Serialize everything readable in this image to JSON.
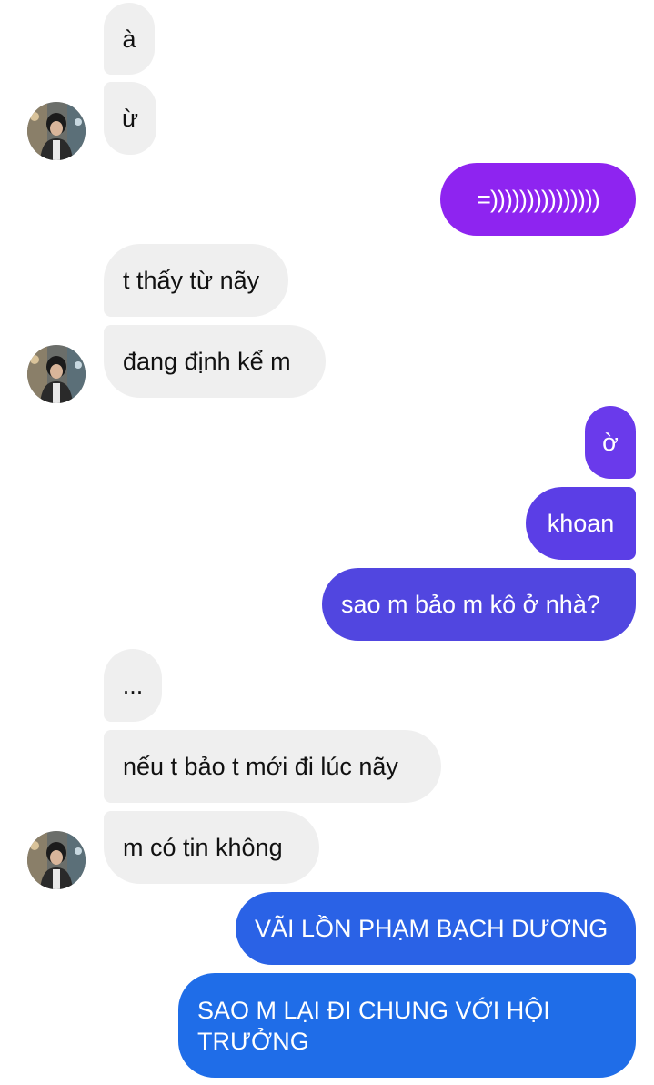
{
  "colors": {
    "incoming_bubble": "#efefef",
    "outgoing_purple": "#8e24f0",
    "outgoing_violet": "#5b3ee6",
    "outgoing_indigo": "#5146e0",
    "outgoing_blue": "#2a62e6",
    "outgoing_blue2": "#1f6de8"
  },
  "avatar": {
    "icon": "profile-photo-icon"
  },
  "messages": [
    {
      "side": "in",
      "text": "à"
    },
    {
      "side": "in",
      "text": "ừ"
    },
    {
      "side": "out",
      "text": "=)))))))))))))))"
    },
    {
      "side": "in",
      "text": "t thấy từ nãy"
    },
    {
      "side": "in",
      "text": "đang định kể m"
    },
    {
      "side": "out",
      "text": "ờ"
    },
    {
      "side": "out",
      "text": "khoan"
    },
    {
      "side": "out",
      "text": "sao m bảo m kô ở nhà?"
    },
    {
      "side": "in",
      "text": "..."
    },
    {
      "side": "in",
      "text": "nếu t bảo t mới đi lúc nãy"
    },
    {
      "side": "in",
      "text": "m có tin không"
    },
    {
      "side": "out",
      "text": "VÃI LỒN PHẠM BẠCH DƯƠNG"
    },
    {
      "side": "out",
      "text": "SAO M LẠI ĐI CHUNG VỚI HỘI TRƯỞNG"
    }
  ]
}
